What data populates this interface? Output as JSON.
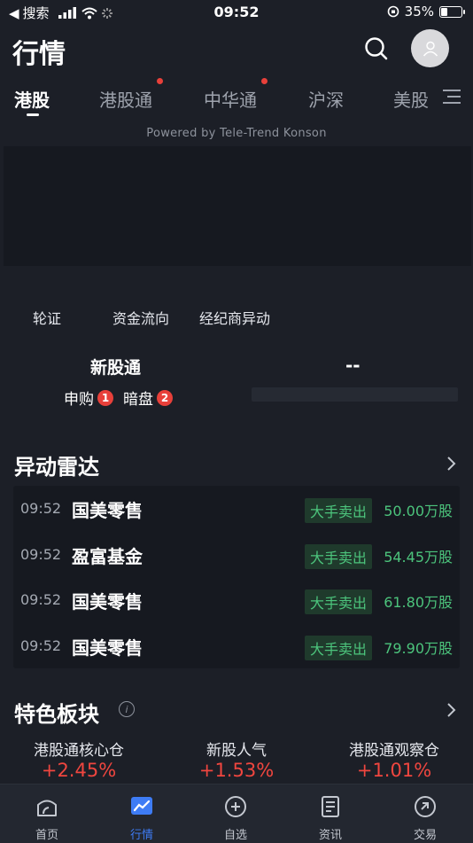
{
  "status_bar": {
    "back_app": "搜索",
    "time": "09:52",
    "battery": "35%",
    "battery_level": 0.35
  },
  "header": {
    "title": "行情"
  },
  "tabs": [
    {
      "label": "港股",
      "active": true,
      "dot": false
    },
    {
      "label": "港股通",
      "active": false,
      "dot": true
    },
    {
      "label": "中华通",
      "active": false,
      "dot": true
    },
    {
      "label": "沪深",
      "active": false,
      "dot": false
    },
    {
      "label": "美股",
      "active": false,
      "dot": false
    }
  ],
  "banner": {
    "credit": "Powered by Tele-Trend Konson"
  },
  "quick_links": [
    "轮证",
    "资金流向",
    "经纪商异动"
  ],
  "ipo": {
    "title": "新股通",
    "value": "--",
    "subscribe_label": "申购",
    "subscribe_count": "1",
    "grey_label": "暗盘",
    "grey_count": "2"
  },
  "radar": {
    "title": "异动雷达",
    "rows": [
      {
        "time": "09:52",
        "name": "国美零售",
        "tag": "大手卖出",
        "qty": "50.00万股"
      },
      {
        "time": "09:52",
        "name": "盈富基金",
        "tag": "大手卖出",
        "qty": "54.45万股"
      },
      {
        "time": "09:52",
        "name": "国美零售",
        "tag": "大手卖出",
        "qty": "61.80万股"
      },
      {
        "time": "09:52",
        "name": "国美零售",
        "tag": "大手卖出",
        "qty": "79.90万股"
      }
    ]
  },
  "sectors": {
    "title": "特色板块",
    "info": "i",
    "items": [
      {
        "name": "港股通核心仓",
        "pct": "+2.45%"
      },
      {
        "name": "新股人气",
        "pct": "+1.53%"
      },
      {
        "name": "港股通观察仓",
        "pct": "+1.01%"
      }
    ]
  },
  "bottom_nav": [
    {
      "label": "首页",
      "icon": "home-icon",
      "active": false
    },
    {
      "label": "行情",
      "icon": "chart-icon",
      "active": true
    },
    {
      "label": "自选",
      "icon": "plus-circle-icon",
      "active": false
    },
    {
      "label": "资讯",
      "icon": "news-icon",
      "active": false
    },
    {
      "label": "交易",
      "icon": "trade-icon",
      "active": false
    }
  ],
  "colors": {
    "up": "#f0463f",
    "down": "#4cc47c",
    "accent": "#3e7cf5",
    "background": "#1c1f27"
  }
}
